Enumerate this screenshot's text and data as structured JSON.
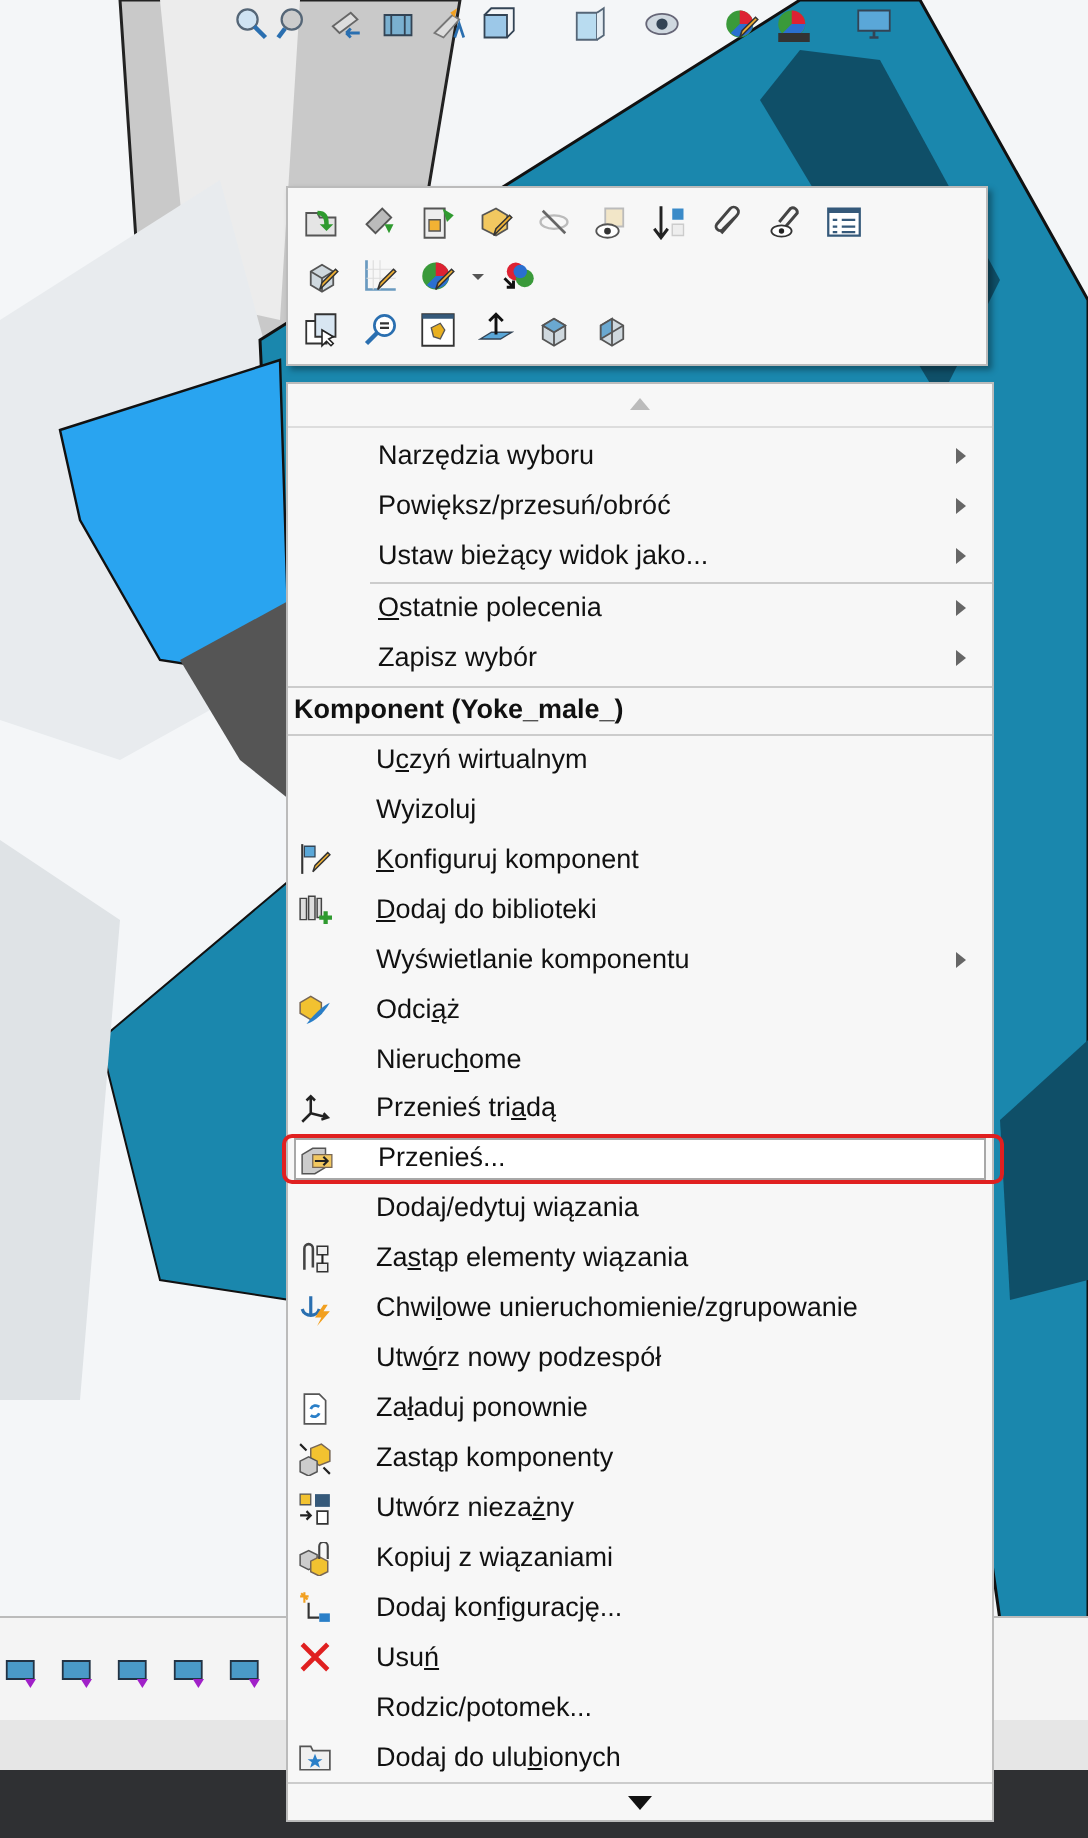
{
  "context_menu": {
    "general_items": [
      {
        "label_parts": [
          {
            "text": "Narzędzia wyboru",
            "underlined": false
          }
        ],
        "submenu": true,
        "separator_after": false
      },
      {
        "label_parts": [
          {
            "text": "Powiększ/przesuń/obróć",
            "underlined": false
          }
        ],
        "submenu": true,
        "separator_after": false
      },
      {
        "label_parts": [
          {
            "text": "Ustaw bieżący widok jako...",
            "underlined": false
          }
        ],
        "submenu": true,
        "separator_after": true
      },
      {
        "label_parts": [
          {
            "text": "O",
            "underlined": true
          },
          {
            "text": "statnie polecenia",
            "underlined": false
          }
        ],
        "submenu": true,
        "separator_after": false
      },
      {
        "label_parts": [
          {
            "text": "Zapisz wybór",
            "underlined": false
          }
        ],
        "submenu": true,
        "separator_after": false
      }
    ],
    "section": {
      "title": "Komponent (Yoke_male_)",
      "items": [
        {
          "label_parts": [
            {
              "text": "U",
              "underlined": false
            },
            {
              "text": "c",
              "underlined": true
            },
            {
              "text": "zyń wirtualnym",
              "underlined": false
            }
          ],
          "submenu": false,
          "selected": false
        },
        {
          "label_parts": [
            {
              "text": "Wyizoluj",
              "underlined": false
            }
          ],
          "submenu": false,
          "selected": false
        },
        {
          "label_parts": [
            {
              "text": "K",
              "underlined": true
            },
            {
              "text": "onfiguruj komponent",
              "underlined": false
            }
          ],
          "submenu": false,
          "selected": false
        },
        {
          "label_parts": [
            {
              "text": "D",
              "underlined": true
            },
            {
              "text": "odaj do biblioteki",
              "underlined": false
            }
          ],
          "submenu": false,
          "selected": false
        },
        {
          "label_parts": [
            {
              "text": "Wyświetlanie komponentu",
              "underlined": false
            }
          ],
          "submenu": true,
          "selected": false
        },
        {
          "label_parts": [
            {
              "text": "Odci",
              "underlined": false
            },
            {
              "text": "ą",
              "underlined": true
            },
            {
              "text": "ż",
              "underlined": false
            }
          ],
          "submenu": false,
          "selected": false
        },
        {
          "label_parts": [
            {
              "text": "Nieruc",
              "underlined": false
            },
            {
              "text": "h",
              "underlined": true
            },
            {
              "text": "ome",
              "underlined": false
            }
          ],
          "submenu": false,
          "selected": false
        },
        {
          "label_parts": [
            {
              "text": "Przenieś tri",
              "underlined": false
            },
            {
              "text": "a",
              "underlined": true
            },
            {
              "text": "dą",
              "underlined": false
            }
          ],
          "submenu": false,
          "selected": false
        },
        {
          "label_parts": [
            {
              "text": "Przenieś...",
              "underlined": false
            }
          ],
          "submenu": false,
          "selected": true
        },
        {
          "label_parts": [
            {
              "text": "Dodaj/edytuj wiązania",
              "underlined": false
            }
          ],
          "submenu": false,
          "selected": false
        },
        {
          "label_parts": [
            {
              "text": "Za",
              "underlined": false
            },
            {
              "text": "s",
              "underlined": true
            },
            {
              "text": "tąp elementy wiązania",
              "underlined": false
            }
          ],
          "submenu": false,
          "selected": false
        },
        {
          "label_parts": [
            {
              "text": "Chwi",
              "underlined": false
            },
            {
              "text": "l",
              "underlined": true
            },
            {
              "text": "owe unieruchomienie/zgrupowanie",
              "underlined": false
            }
          ],
          "submenu": false,
          "selected": false
        },
        {
          "label_parts": [
            {
              "text": "Utw",
              "underlined": false
            },
            {
              "text": "ó",
              "underlined": true
            },
            {
              "text": "rz nowy podzespół",
              "underlined": false
            }
          ],
          "submenu": false,
          "selected": false
        },
        {
          "label_parts": [
            {
              "text": "Za",
              "underlined": false
            },
            {
              "text": "ł",
              "underlined": true
            },
            {
              "text": "aduj ponownie",
              "underlined": false
            }
          ],
          "submenu": false,
          "selected": false
        },
        {
          "label_parts": [
            {
              "text": "Zastąp komponenty",
              "underlined": false
            }
          ],
          "submenu": false,
          "selected": false
        },
        {
          "label_parts": [
            {
              "text": "Utwórz nieza",
              "underlined": false
            },
            {
              "text": "ż",
              "underlined": true
            },
            {
              "text": "ny",
              "underlined": false
            }
          ],
          "submenu": false,
          "selected": false
        },
        {
          "label_parts": [
            {
              "text": "Kopiuj z wiązaniami",
              "underlined": false
            }
          ],
          "submenu": false,
          "selected": false
        },
        {
          "label_parts": [
            {
              "text": "Dodaj kon",
              "underlined": false
            },
            {
              "text": "f",
              "underlined": true
            },
            {
              "text": "igurację...",
              "underlined": false
            }
          ],
          "submenu": false,
          "selected": false
        },
        {
          "label_parts": [
            {
              "text": "Usu",
              "underlined": false
            },
            {
              "text": "ń",
              "underlined": true
            }
          ],
          "submenu": false,
          "selected": false
        },
        {
          "label_parts": [
            {
              "text": "Rodzic/potomek...",
              "underlined": false
            }
          ],
          "submenu": false,
          "selected": false
        },
        {
          "label_parts": [
            {
              "text": "Dodaj do ulu",
              "underlined": false
            },
            {
              "text": "b",
              "underlined": true
            },
            {
              "text": "ionych",
              "underlined": false
            }
          ],
          "submenu": false,
          "selected": false
        }
      ]
    }
  }
}
